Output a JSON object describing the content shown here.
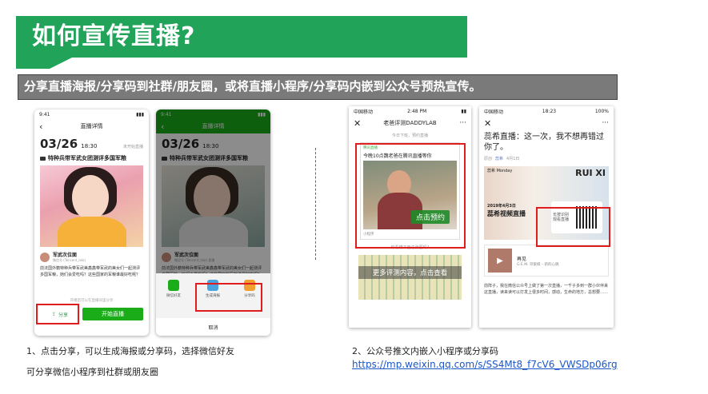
{
  "slide": {
    "title": "如何宣传直播?",
    "subtitle": "分享直播海报/分享码到社群/朋友圈，或将直播小程序/分享码内嵌到公众号预热宣传。",
    "caption_left_line1": "1、点击分享，可以生成海报或分享码，选择微信好友",
    "caption_left_line2": "可分享微信小程序到社群或朋友圈",
    "caption_right_line1": "2、公众号推文内嵌入小程序或分享码",
    "caption_right_link": "https://mp.weixin.qq.com/s/SS4Mt8_f7cV6_VWSDp06rg",
    "colors": {
      "title_bg": "#21a35a",
      "subtitle_bg": "#7a7a7a",
      "highlight": "#e01c1c",
      "wechat_green": "#1aad19"
    }
  },
  "phone1": {
    "time": "9:41",
    "nav_title": "直播详情",
    "date": "03/26",
    "time_slot": "18:30",
    "status": "未开始直播",
    "live_title": "特种兵带军武女团测评多国军粮",
    "author_name": "军武次位面",
    "author_sub": "微信号 (Tencent_lolo)",
    "desc": "前法国外籍特种兵带军武美鑫鑫带军武的美女们一起测评多国军粮，她们会爱吃吗？这些国家的军粮谁最好吃呢？",
    "share_label": "分享",
    "start_label": "开始直播",
    "footer_note": "开播后可以在直播间里分享"
  },
  "phone2": {
    "time": "9:41",
    "nav_title": "直播详情",
    "date": "03/26",
    "time_slot": "18:30",
    "live_title": "特种兵带军武女团测评多国军粮",
    "author_name": "军武次位面",
    "author_sub": "微信号 (Tencent_lolo) 直播",
    "desc": "前法国外籍特种兵带军武美鑫鑫带军武的美女们一起测评多国军粮，她们会爱吃吗？这些国家的军粮谁最好吃呢？",
    "opt1": "微信好友",
    "opt2": "生成海报",
    "opt3": "分享码",
    "cancel": "取消"
  },
  "phone3": {
    "carrier": "中国移动",
    "time": "2:48 PM",
    "nav_title": "老爸评测DADDYLAB",
    "intro": "今日下班，预约直播",
    "card_source": "腾讯直播",
    "card_title": "今晚10点魏老爸在腾讯直播等你",
    "book_btn": "点击预约",
    "mini_label": "小程序",
    "more_hint": "你看懂下面这张图吗?",
    "banner": "更多评测内容，点击查看"
  },
  "phone4": {
    "carrier": "中国移动",
    "time": "18:23",
    "battery": "100%",
    "headline": "蕊希直播：这一次，我不想再错过你了。",
    "source_prefix": "原创",
    "source_name": "蕊希",
    "source_date": "4月1日",
    "poster_top": "蕊希 Monday",
    "poster_brand": "RUI XI",
    "poster_date": "2019年4月3日",
    "poster_title": "蕊希视频直播",
    "qr_text": "长按识别 观看直播",
    "song_title": "再见",
    "song_sub": "G.E.M. 邓紫棋 – 新的心跳",
    "body": "前阵子，我在微信公众号上做了第一次直播，一千子多到一群小伙伴来这直播，读来读可以打发上很多时间，感动，生命的地方，总想要……"
  }
}
